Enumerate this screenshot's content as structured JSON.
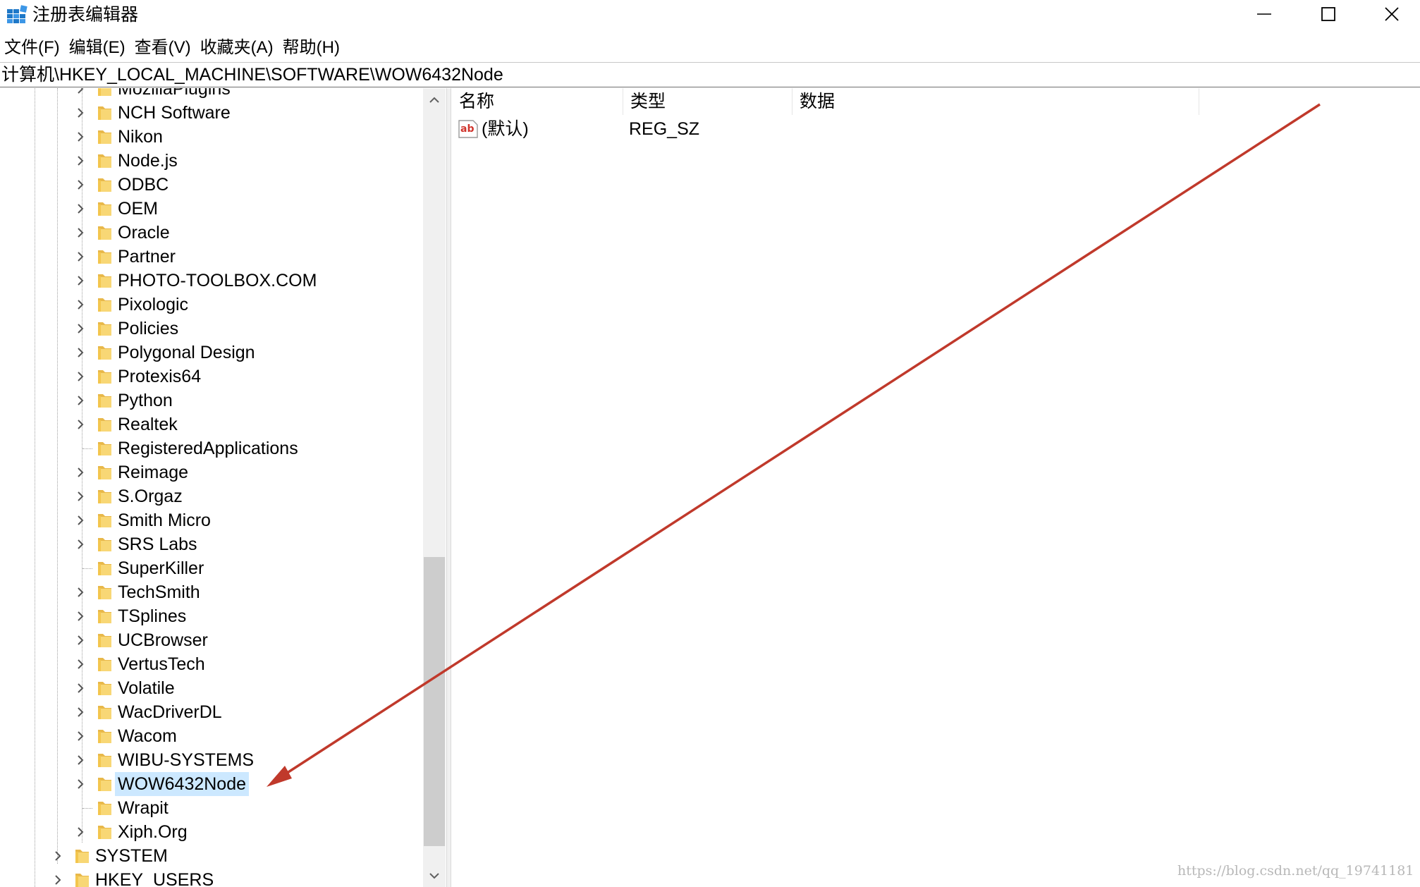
{
  "window": {
    "title": "注册表编辑器",
    "icon": "regedit-icon",
    "controls": [
      "minimize-icon",
      "maximize-icon",
      "close-icon"
    ]
  },
  "menu": [
    "文件(F)",
    "编辑(E)",
    "查看(V)",
    "收藏夹(A)",
    "帮助(H)"
  ],
  "address": "计算机\\HKEY_LOCAL_MACHINE\\SOFTWARE\\WOW6432Node",
  "tree": {
    "items": [
      {
        "label": "MozillaPlugins",
        "expandable": true
      },
      {
        "label": "NCH Software",
        "expandable": true
      },
      {
        "label": "Nikon",
        "expandable": true
      },
      {
        "label": "Node.js",
        "expandable": true
      },
      {
        "label": "ODBC",
        "expandable": true
      },
      {
        "label": "OEM",
        "expandable": true
      },
      {
        "label": "Oracle",
        "expandable": true
      },
      {
        "label": "Partner",
        "expandable": true
      },
      {
        "label": "PHOTO-TOOLBOX.COM",
        "expandable": true
      },
      {
        "label": "Pixologic",
        "expandable": true
      },
      {
        "label": "Policies",
        "expandable": true
      },
      {
        "label": "Polygonal Design",
        "expandable": true
      },
      {
        "label": "Protexis64",
        "expandable": true
      },
      {
        "label": "Python",
        "expandable": true
      },
      {
        "label": "Realtek",
        "expandable": true
      },
      {
        "label": "RegisteredApplications",
        "expandable": false
      },
      {
        "label": "Reimage",
        "expandable": true
      },
      {
        "label": "S.Orgaz",
        "expandable": true
      },
      {
        "label": "Smith Micro",
        "expandable": true
      },
      {
        "label": "SRS Labs",
        "expandable": true
      },
      {
        "label": "SuperKiller",
        "expandable": false
      },
      {
        "label": "TechSmith",
        "expandable": true
      },
      {
        "label": "TSplines",
        "expandable": true
      },
      {
        "label": "UCBrowser",
        "expandable": true
      },
      {
        "label": "VertusTech",
        "expandable": true
      },
      {
        "label": "Volatile",
        "expandable": true
      },
      {
        "label": "WacDriverDL",
        "expandable": true
      },
      {
        "label": "Wacom",
        "expandable": true
      },
      {
        "label": "WIBU-SYSTEMS",
        "expandable": true
      },
      {
        "label": "WOW6432Node",
        "expandable": true,
        "selected": true
      },
      {
        "label": "Wrapit",
        "expandable": false
      },
      {
        "label": "Xiph.Org",
        "expandable": true
      }
    ],
    "parent_items": [
      {
        "label": "SYSTEM",
        "expandable": true
      },
      {
        "label": "HKEY_USERS",
        "expandable": true
      }
    ]
  },
  "list": {
    "columns": [
      "名称",
      "类型",
      "数据"
    ],
    "rows": [
      {
        "name": "(默认)",
        "type": "REG_SZ",
        "data": "",
        "icon": "string-value-icon"
      }
    ]
  },
  "annotation": {
    "color": "#c0392b"
  },
  "watermark": "https://blog.csdn.net/qq_19741181",
  "colors": {
    "selection": "#cce8ff",
    "folder": "#f8d775",
    "scroll_thumb": "#cdcdcd"
  }
}
